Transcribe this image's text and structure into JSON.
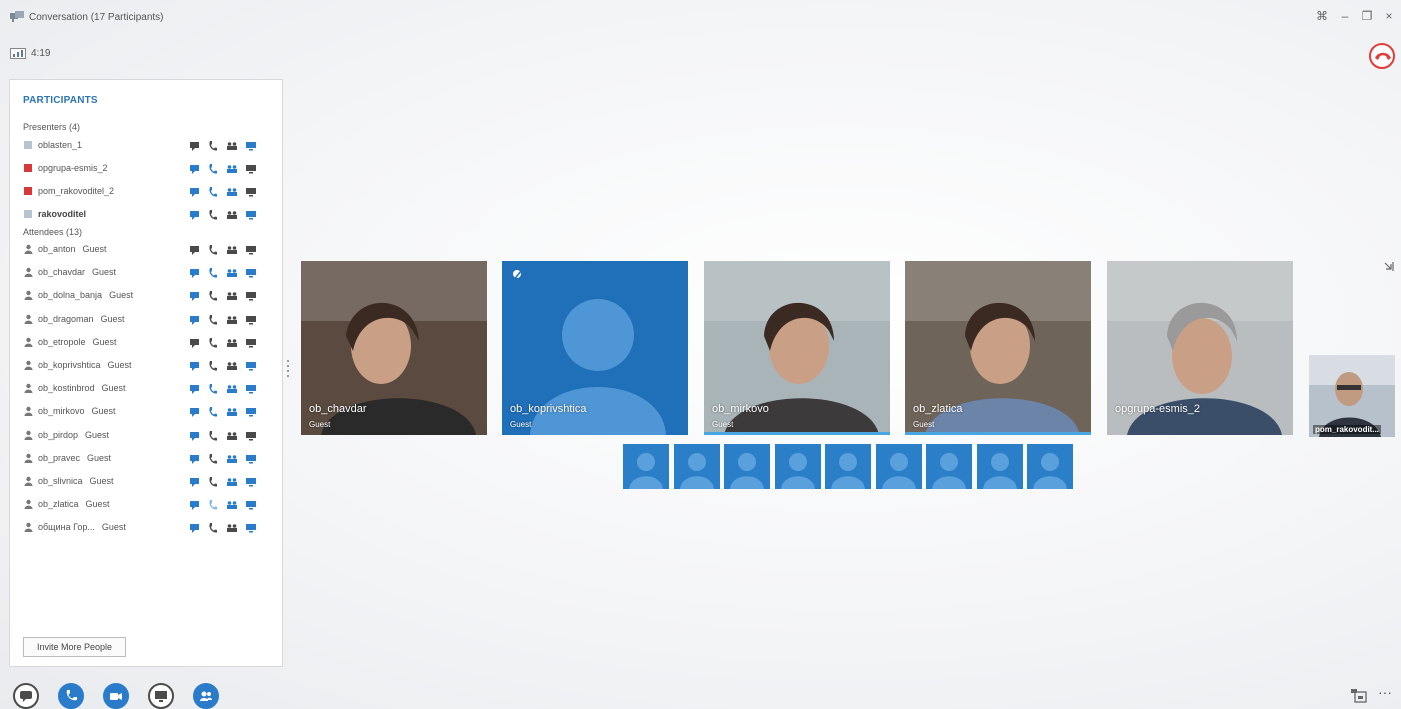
{
  "window": {
    "title": "Conversation (17 Participants)",
    "controls": [
      "minimize-compact",
      "minimize",
      "restore",
      "close"
    ],
    "close_label": "×",
    "minimize_label": "–"
  },
  "call": {
    "duration": "4:19"
  },
  "panel": {
    "title": "PARTICIPANTS",
    "presenters_label": "Presenters (4)",
    "attendees_label": "Attendees (13)",
    "presenters": [
      {
        "name": "oblasten_1",
        "color": "#b7c3cf",
        "bold": false,
        "modal_colors": [
          "#4a4a4a",
          "#4a4a4a",
          "#4a4a4a",
          "#2a7bc9"
        ]
      },
      {
        "name": "opgrupa-esmis_2",
        "color": "#d93838",
        "bold": false,
        "modal_colors": [
          "#2a7bc9",
          "#2a7bc9",
          "#2a7bc9",
          "#4a4a4a"
        ]
      },
      {
        "name": "pom_rakovoditel_2",
        "color": "#d93838",
        "bold": false,
        "modal_colors": [
          "#2a7bc9",
          "#2a7bc9",
          "#2a7bc9",
          "#4a4a4a"
        ]
      },
      {
        "name": "rakovoditel",
        "color": "#b7c3cf",
        "bold": true,
        "modal_colors": [
          "#2a7bc9",
          "#4a4a4a",
          "#4a4a4a",
          "#2a7bc9"
        ]
      }
    ],
    "guest_label": "Guest",
    "attendees": [
      {
        "name": "ob_anton",
        "modal_colors": [
          "#4a4a4a",
          "#4a4a4a",
          "#4a4a4a",
          "#4a4a4a"
        ]
      },
      {
        "name": "ob_chavdar",
        "modal_colors": [
          "#2a7bc9",
          "#2a7bc9",
          "#2a7bc9",
          "#2a7bc9"
        ]
      },
      {
        "name": "ob_dolna_banja",
        "modal_colors": [
          "#2a7bc9",
          "#4a4a4a",
          "#4a4a4a",
          "#4a4a4a"
        ]
      },
      {
        "name": "ob_dragoman",
        "modal_colors": [
          "#2a7bc9",
          "#4a4a4a",
          "#4a4a4a",
          "#4a4a4a"
        ]
      },
      {
        "name": "ob_etropole",
        "modal_colors": [
          "#4a4a4a",
          "#4a4a4a",
          "#4a4a4a",
          "#4a4a4a"
        ]
      },
      {
        "name": "ob_koprivshtica",
        "modal_colors": [
          "#2a7bc9",
          "#4a4a4a",
          "#4a4a4a",
          "#2a7bc9"
        ]
      },
      {
        "name": "ob_kostinbrod",
        "modal_colors": [
          "#2a7bc9",
          "#2a7bc9",
          "#2a7bc9",
          "#2a7bc9"
        ]
      },
      {
        "name": "ob_mirkovo",
        "modal_colors": [
          "#2a7bc9",
          "#2a7bc9",
          "#2a7bc9",
          "#2a7bc9"
        ]
      },
      {
        "name": "ob_pirdop",
        "modal_colors": [
          "#2a7bc9",
          "#4a4a4a",
          "#4a4a4a",
          "#4a4a4a"
        ]
      },
      {
        "name": "ob_pravec",
        "modal_colors": [
          "#2a7bc9",
          "#4a4a4a",
          "#2a7bc9",
          "#2a7bc9"
        ]
      },
      {
        "name": "ob_slivnica",
        "modal_colors": [
          "#2a7bc9",
          "#4a4a4a",
          "#2a7bc9",
          "#2a7bc9"
        ]
      },
      {
        "name": "ob_zlatica",
        "modal_colors": [
          "#2a7bc9",
          "#7fb8e6",
          "#2a7bc9",
          "#2a7bc9"
        ]
      },
      {
        "name": "община Гор...",
        "modal_colors": [
          "#2a7bc9",
          "#4a4a4a",
          "#4a4a4a",
          "#2a7bc9"
        ]
      }
    ],
    "invite_label": "Invite More People"
  },
  "stage": {
    "tiles": [
      {
        "name": "ob_chavdar",
        "sub": "Guest",
        "kind": "video",
        "bg": "#5a4a40"
      },
      {
        "name": "ob_koprivshtica",
        "sub": "Guest",
        "kind": "avatar",
        "bg": "#1f6fb9"
      },
      {
        "name": "ob_mirkovo",
        "sub": "Guest",
        "kind": "video",
        "bg": "#a9b4b8"
      },
      {
        "name": "ob_zlatica",
        "sub": "Guest",
        "kind": "video",
        "bg": "#6f6459"
      },
      {
        "name": "opgrupa-esmis_2",
        "sub": "",
        "kind": "video",
        "bg": "#b9bdbf"
      }
    ],
    "self_view": {
      "name": "pom_rakovodit..."
    },
    "thumbnail_count": 9,
    "accent": "#2b7fc9"
  },
  "toolbar": {
    "buttons": [
      "im-icon",
      "phone-icon",
      "video-icon",
      "present-icon",
      "participants-icon"
    ]
  }
}
